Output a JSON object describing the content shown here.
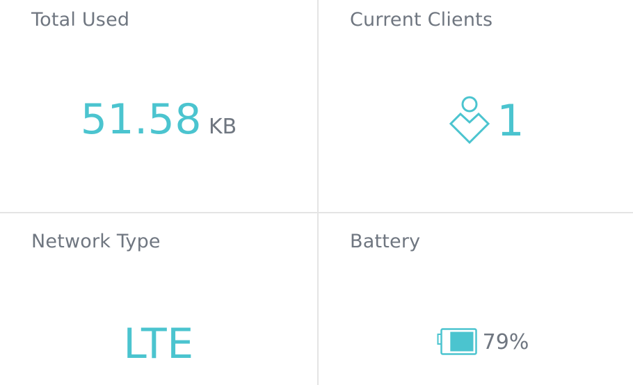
{
  "tiles": {
    "total_used": {
      "title": "Total Used",
      "value": "51.58",
      "unit": "KB"
    },
    "current_clients": {
      "title": "Current Clients",
      "count": "1",
      "icon": "user-icon"
    },
    "network_type": {
      "title": "Network Type",
      "value": "LTE"
    },
    "battery": {
      "title": "Battery",
      "percent_label": "79%",
      "level": 0.79,
      "icon": "battery-icon"
    }
  },
  "colors": {
    "accent": "#4bc4cf",
    "label": "#6f7680",
    "divider": "#e4e4e4"
  }
}
